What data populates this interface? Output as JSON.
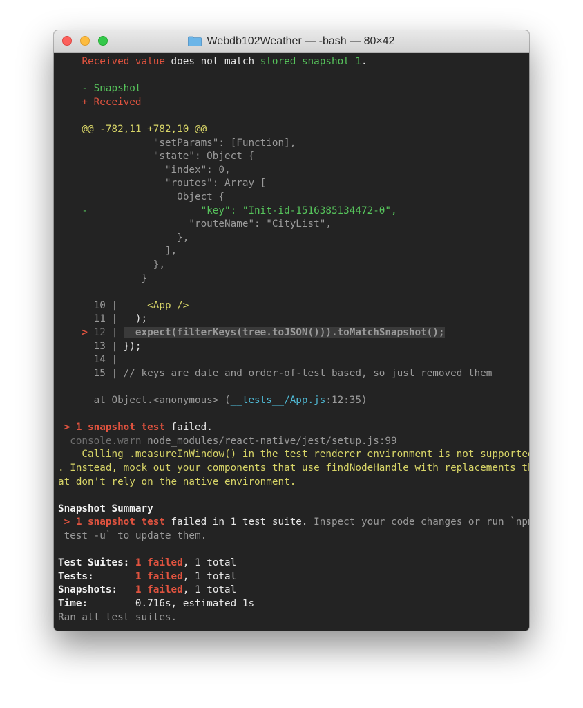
{
  "window": {
    "title": "Webdb102Weather — -bash — 80×42"
  },
  "terminal": {
    "lines": [
      [
        {
          "t": "    "
        },
        {
          "t": "Received value",
          "c": "red"
        },
        {
          "t": " does not match "
        },
        {
          "t": "stored snapshot 1",
          "c": "green"
        },
        {
          "t": "."
        }
      ],
      [],
      [
        {
          "t": "    - Snapshot",
          "c": "green"
        }
      ],
      [
        {
          "t": "    + Received",
          "c": "red"
        }
      ],
      [],
      [
        {
          "t": "    @@ -782,11 +782,10 @@",
          "c": "yellow"
        }
      ],
      [
        {
          "t": "                \"setParams\": [Function],",
          "c": "dim"
        }
      ],
      [
        {
          "t": "                \"state\": Object {",
          "c": "dim"
        }
      ],
      [
        {
          "t": "                  \"index\": 0,",
          "c": "dim"
        }
      ],
      [
        {
          "t": "                  \"routes\": Array [",
          "c": "dim"
        }
      ],
      [
        {
          "t": "                    Object {",
          "c": "dim"
        }
      ],
      [
        {
          "t": "    -                   \"key\": \"Init-id-1516385134472-0\",",
          "c": "green"
        }
      ],
      [
        {
          "t": "                      \"routeName\": \"CityList\",",
          "c": "dim"
        }
      ],
      [
        {
          "t": "                    },",
          "c": "dim"
        }
      ],
      [
        {
          "t": "                  ],",
          "c": "dim"
        }
      ],
      [
        {
          "t": "                },",
          "c": "dim"
        }
      ],
      [
        {
          "t": "              }",
          "c": "dim"
        }
      ],
      [],
      [
        {
          "t": "      10 | ",
          "c": "dim"
        },
        {
          "t": "    <App />",
          "c": "yellow"
        }
      ],
      [
        {
          "t": "      11 | ",
          "c": "dim"
        },
        {
          "t": "  );"
        }
      ],
      [
        {
          "t": "    > ",
          "c": "red bold"
        },
        {
          "t": "12 | ",
          "c": "dimmer"
        },
        {
          "t": "  expect(filterKeys(tree.toJSON())).toMatchSnapshot();",
          "c": "dim bold",
          "hl": true
        }
      ],
      [
        {
          "t": "      13 | ",
          "c": "dim"
        },
        {
          "t": "});"
        }
      ],
      [
        {
          "t": "      14 |",
          "c": "dim"
        }
      ],
      [
        {
          "t": "      15 | // keys are date and order-of-test based, so just removed them",
          "c": "dim"
        }
      ],
      [],
      [
        {
          "t": "      at Object.<anonymous> (",
          "c": "dim"
        },
        {
          "t": "__tests__/App.js",
          "c": "cyan"
        },
        {
          "t": ":12:35)",
          "c": "dim"
        }
      ],
      [],
      [
        {
          "t": " > 1 snapshot test",
          "c": "red bold"
        },
        {
          "t": " failed."
        }
      ],
      [
        {
          "t": "  console.warn",
          "c": "dimmer"
        },
        {
          "t": " node_modules/react-native/jest/setup.js:99",
          "c": "dim"
        }
      ],
      [
        {
          "t": "    Calling .measureInWindow() in the test renderer environment is not supported",
          "c": "yellow"
        }
      ],
      [
        {
          "t": ". Instead, mock out your components that use findNodeHandle with replacements th",
          "c": "yellow"
        }
      ],
      [
        {
          "t": "at don't rely on the native environment.",
          "c": "yellow"
        }
      ],
      [],
      [
        {
          "t": "Snapshot Summary",
          "c": "white bold"
        }
      ],
      [
        {
          "t": " > 1 snapshot test",
          "c": "red bold"
        },
        {
          "t": " failed in 1 test suite. "
        },
        {
          "t": "Inspect your code changes or run `npm",
          "c": "dim"
        }
      ],
      [
        {
          "t": " test -u` to update them.",
          "c": "dim"
        }
      ],
      [],
      [
        {
          "t": "Test Suites: ",
          "c": "white bold"
        },
        {
          "t": "1 failed",
          "c": "red bold"
        },
        {
          "t": ", 1 total"
        }
      ],
      [
        {
          "t": "Tests:       ",
          "c": "white bold"
        },
        {
          "t": "1 failed",
          "c": "red bold"
        },
        {
          "t": ", 1 total"
        }
      ],
      [
        {
          "t": "Snapshots:   ",
          "c": "white bold"
        },
        {
          "t": "1 failed",
          "c": "red bold"
        },
        {
          "t": ", 1 total"
        }
      ],
      [
        {
          "t": "Time:        ",
          "c": "white bold"
        },
        {
          "t": "0.716s, estimated 1s"
        }
      ],
      [
        {
          "t": "Ran all test suites.",
          "c": "dim"
        }
      ]
    ]
  },
  "colors": {
    "background": "#232323",
    "red": "#e0533f",
    "green": "#56c25b",
    "yellow": "#d7d467",
    "cyan": "#4fb8d3"
  }
}
